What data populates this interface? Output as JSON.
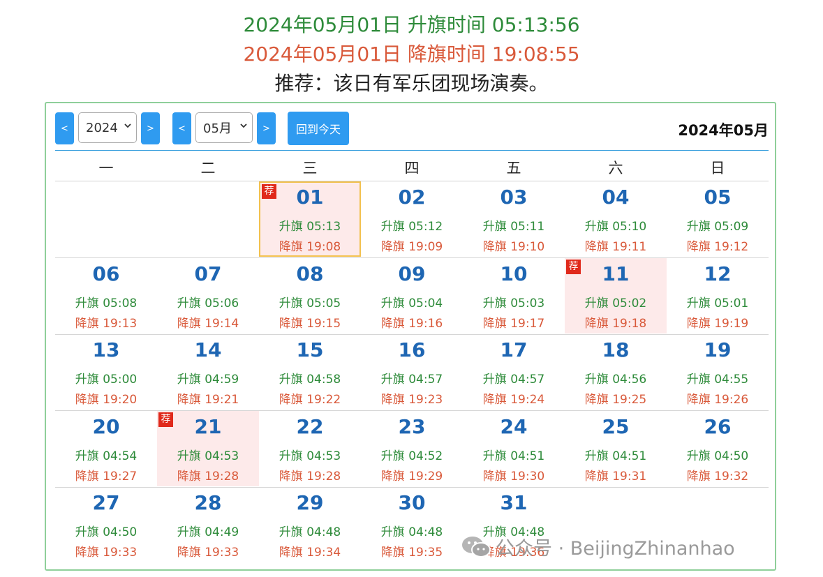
{
  "header": {
    "rise_text": "2024年05月01日 升旗时间 05:13:56",
    "set_text": "2024年05月01日 降旗时间 19:08:55",
    "recommend_text": "推荐：该日有军乐团现场演奏。"
  },
  "toolbar": {
    "prev_year": "<",
    "year_value": "2024",
    "next_year": ">",
    "prev_month": "<",
    "month_value": "05月",
    "next_month": ">",
    "today_label": "回到今天",
    "month_title": "2024年05月"
  },
  "weekdays": [
    "一",
    "二",
    "三",
    "四",
    "五",
    "六",
    "日"
  ],
  "calendar": {
    "rise_prefix": "升旗",
    "set_prefix": "降旗",
    "badge_label": "荐",
    "leading_blanks": 2,
    "days": [
      {
        "day": "01",
        "rise": "05:13",
        "set": "19:08",
        "recommended": true,
        "today": true
      },
      {
        "day": "02",
        "rise": "05:12",
        "set": "19:09"
      },
      {
        "day": "03",
        "rise": "05:11",
        "set": "19:10"
      },
      {
        "day": "04",
        "rise": "05:10",
        "set": "19:11"
      },
      {
        "day": "05",
        "rise": "05:09",
        "set": "19:12"
      },
      {
        "day": "06",
        "rise": "05:08",
        "set": "19:13"
      },
      {
        "day": "07",
        "rise": "05:06",
        "set": "19:14"
      },
      {
        "day": "08",
        "rise": "05:05",
        "set": "19:15"
      },
      {
        "day": "09",
        "rise": "05:04",
        "set": "19:16"
      },
      {
        "day": "10",
        "rise": "05:03",
        "set": "19:17"
      },
      {
        "day": "11",
        "rise": "05:02",
        "set": "19:18",
        "recommended": true
      },
      {
        "day": "12",
        "rise": "05:01",
        "set": "19:19"
      },
      {
        "day": "13",
        "rise": "05:00",
        "set": "19:20"
      },
      {
        "day": "14",
        "rise": "04:59",
        "set": "19:21"
      },
      {
        "day": "15",
        "rise": "04:58",
        "set": "19:22"
      },
      {
        "day": "16",
        "rise": "04:57",
        "set": "19:23"
      },
      {
        "day": "17",
        "rise": "04:57",
        "set": "19:24"
      },
      {
        "day": "18",
        "rise": "04:56",
        "set": "19:25"
      },
      {
        "day": "19",
        "rise": "04:55",
        "set": "19:26"
      },
      {
        "day": "20",
        "rise": "04:54",
        "set": "19:27"
      },
      {
        "day": "21",
        "rise": "04:53",
        "set": "19:28",
        "recommended": true
      },
      {
        "day": "22",
        "rise": "04:53",
        "set": "19:28"
      },
      {
        "day": "23",
        "rise": "04:52",
        "set": "19:29"
      },
      {
        "day": "24",
        "rise": "04:51",
        "set": "19:30"
      },
      {
        "day": "25",
        "rise": "04:51",
        "set": "19:31"
      },
      {
        "day": "26",
        "rise": "04:50",
        "set": "19:32"
      },
      {
        "day": "27",
        "rise": "04:50",
        "set": "19:33"
      },
      {
        "day": "28",
        "rise": "04:49",
        "set": "19:33"
      },
      {
        "day": "29",
        "rise": "04:48",
        "set": "19:34"
      },
      {
        "day": "30",
        "rise": "04:48",
        "set": "19:35"
      },
      {
        "day": "31",
        "rise": "04:48",
        "set": "19:36"
      }
    ]
  },
  "watermark": {
    "text": "公众号 · BeijingZhinanhao",
    "icon": "wechat-icon"
  },
  "colors": {
    "rise_green": "#2e8b3a",
    "set_red": "#d9593a",
    "day_blue": "#1e66b3",
    "button_blue": "#2f9bf0",
    "frame_green": "#8fcf9a",
    "recommend_bg": "#fdeaea",
    "today_border": "#f2c14e",
    "badge_red": "#e0291b"
  }
}
